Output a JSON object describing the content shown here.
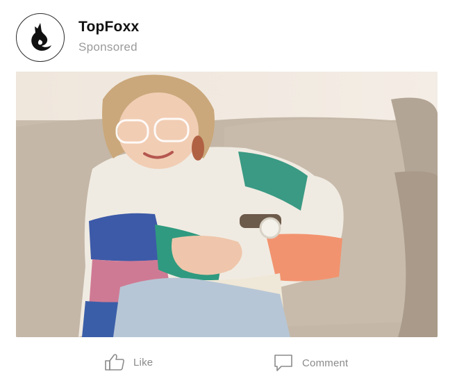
{
  "post": {
    "brand_name": "TopFoxx",
    "sponsored_label": "Sponsored",
    "logo_icon": "fox-logo-icon",
    "image_description_alt": "",
    "actions": {
      "like_label": "Like",
      "like_icon": "thumbs-up-icon",
      "comment_label": "Comment",
      "comment_icon": "comment-bubble-icon"
    },
    "colors": {
      "text_primary": "#111111",
      "text_secondary": "#9a9a9a",
      "action_text": "#8a8a8a"
    }
  }
}
